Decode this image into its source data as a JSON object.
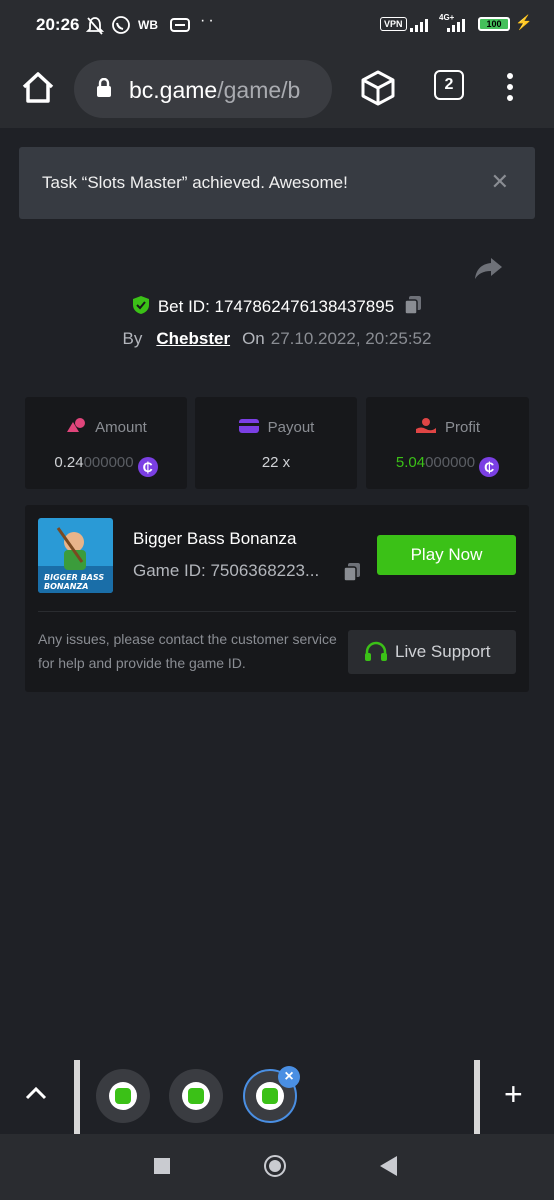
{
  "status_bar": {
    "time": "20:26",
    "carrier_tag": "WB",
    "overflow": "··",
    "vpn": "VPN",
    "net": "4G+",
    "battery": "100"
  },
  "browser": {
    "url_host": "bc.game",
    "url_path": "/game/b",
    "tab_count": "2"
  },
  "toast": {
    "message": "Task “Slots Master” achieved. Awesome!",
    "close": "✕"
  },
  "bet": {
    "id_label": "Bet ID: 1747862476138437895",
    "by_label": "By",
    "user": "Chebster",
    "on_label": "On",
    "datetime": "27.10.2022, 20:25:52"
  },
  "stats": {
    "amount_label": "Amount",
    "amount_value_main": "0.24",
    "amount_value_dim": "000000",
    "payout_label": "Payout",
    "payout_value": "22 x",
    "profit_label": "Profit",
    "profit_value_main": "5.04",
    "profit_value_dim": "000000",
    "coin_symbol": "₵",
    "colors": {
      "profit": "#3bc117",
      "amount_icon": "#e0457b",
      "payout_icon": "#7b3fe4",
      "profit_icon": "#e04545"
    }
  },
  "game": {
    "name": "Bigger Bass Bonanza",
    "id_label": "Game ID: 7506368223...",
    "thumb_text_1": "BIGGER BASS",
    "thumb_text_2": "BONANZA",
    "play_label": "Play Now",
    "issue_text": "Any issues, please contact the customer service for help and provide the game ID.",
    "support_label": "Live Support"
  },
  "tab_switcher": {
    "close_symbol": "×",
    "add_symbol": "+"
  }
}
